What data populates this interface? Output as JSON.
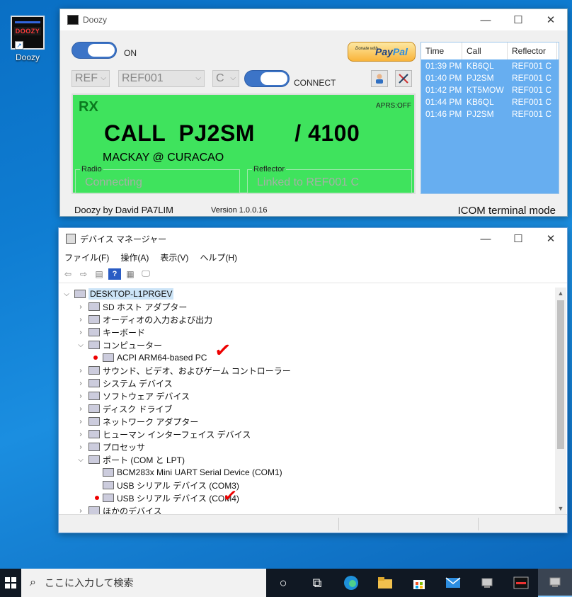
{
  "desktop": {
    "icon_label": "Doozy",
    "icon_logo": "DOOZY"
  },
  "doozy": {
    "title": "Doozy",
    "on_label": "ON",
    "connect_label": "CONNECT",
    "combo_mode": "REF",
    "combo_reflector": "REF001",
    "combo_module": "C",
    "paypal_donate": "Donate with",
    "paypal_pay": "Pay",
    "paypal_pal": "Pal",
    "rx": "RX",
    "aprs": "APRS:OFF",
    "call_line": "CALL  PJ2SM      / 4100",
    "qth": "MACKAY @ CURACAO",
    "radio_caption": "Radio",
    "radio_value": "Connecting",
    "reflector_caption": "Reflector",
    "reflector_value": "Linked to REF001 C",
    "lastheard": {
      "headers": [
        "Time",
        "Call",
        "Reflector"
      ],
      "rows": [
        [
          "01:39 PM",
          "KB6QL",
          "REF001 C"
        ],
        [
          "01:40 PM",
          "PJ2SM",
          "REF001 C"
        ],
        [
          "01:42 PM",
          "KT5MOW",
          "REF001 C"
        ],
        [
          "01:44 PM",
          "KB6QL",
          "REF001 C"
        ],
        [
          "01:46 PM",
          "PJ2SM",
          "REF001 C"
        ]
      ]
    },
    "footer_author": "Doozy by David PA7LIM",
    "footer_version": "Version  1.0.0.16",
    "footer_mode": "ICOM terminal mode",
    "colors": {
      "panel": "#3fe35d",
      "list": "#67aef0",
      "toggle": "#3c74c7"
    }
  },
  "devmgr": {
    "title": "デバイス マネージャー",
    "menu": [
      "ファイル(F)",
      "操作(A)",
      "表示(V)",
      "ヘルプ(H)"
    ],
    "root": "DESKTOP-L1PRGEV",
    "nodes": [
      "SD ホスト アダプター",
      "オーディオの入力および出力",
      "キーボード",
      "コンピューター",
      "ACPI ARM64-based PC",
      "サウンド、ビデオ、およびゲーム コントローラー",
      "システム デバイス",
      "ソフトウェア デバイス",
      "ディスク ドライブ",
      "ネットワーク アダプター",
      "ヒューマン インターフェイス デバイス",
      "プロセッサ",
      "ポート (COM と LPT)",
      "BCM283x Mini UART Serial Device (COM1)",
      "USB シリアル デバイス (COM3)",
      "USB シリアル デバイス (COM4)",
      "ほかのデバイス"
    ]
  },
  "taskbar": {
    "search_placeholder": "ここに入力して検索"
  }
}
